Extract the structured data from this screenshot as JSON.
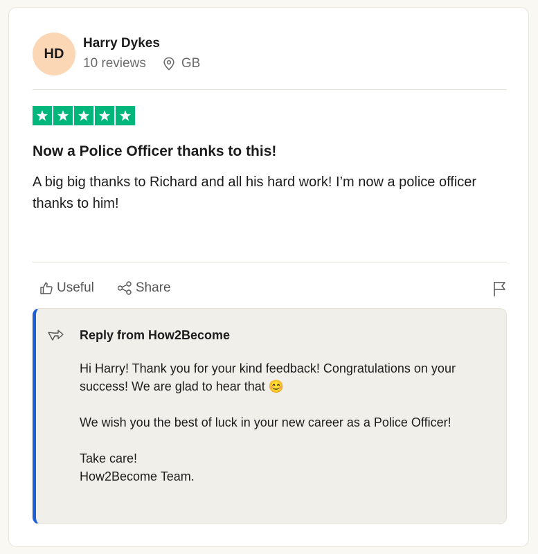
{
  "reviewer": {
    "initials": "HD",
    "name": "Harry Dykes",
    "reviews": "10 reviews",
    "country": "GB",
    "avatar_color": "#fcd7b6"
  },
  "rating": {
    "stars": 5,
    "max": 5,
    "color": "#00b67a"
  },
  "review": {
    "title": "Now a Police Officer thanks to this!",
    "body": "A big big thanks to Richard and all his hard work! I’m now a police officer thanks to him!"
  },
  "actions": {
    "useful_label": "Useful",
    "share_label": "Share"
  },
  "reply": {
    "heading": "Reply from How2Become",
    "paragraph1": "Hi Harry! Thank you for your kind feedback! Congratulations on your success! We are glad to hear that 😊",
    "paragraph2": "We wish you the best of luck in your new career as a Police Officer!",
    "paragraph3_line1": "Take care!",
    "paragraph3_line2": "How2Become Team.",
    "accent_color": "#1f5fd6"
  },
  "icons": {
    "location": "location-pin-icon",
    "useful": "thumbs-up-icon",
    "share": "share-icon",
    "flag": "flag-icon",
    "reply": "reply-arrow-icon",
    "star": "star-icon"
  }
}
